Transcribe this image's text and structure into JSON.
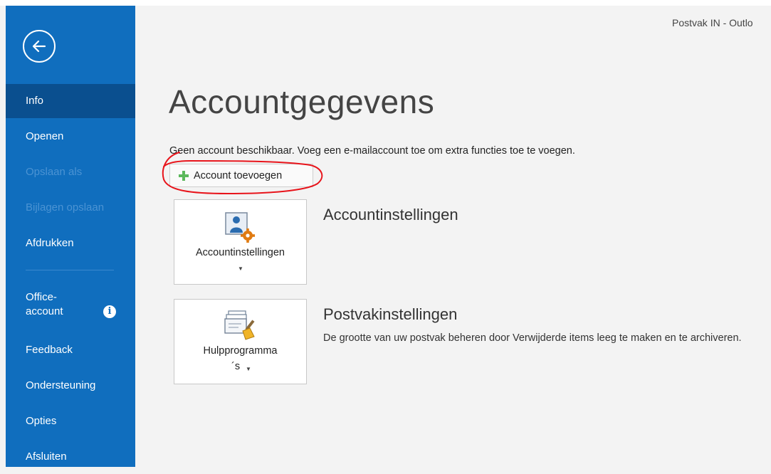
{
  "window": {
    "title": "Postvak IN - Outlo"
  },
  "sidebar": {
    "back_label": "Terug",
    "items": [
      {
        "label": "Info",
        "state": "selected"
      },
      {
        "label": "Openen",
        "state": "enabled"
      },
      {
        "label": "Opslaan als",
        "state": "disabled"
      },
      {
        "label": "Bijlagen opslaan",
        "state": "disabled"
      },
      {
        "label": "Afdrukken",
        "state": "enabled"
      }
    ],
    "office_account": {
      "line1": "Office-",
      "line2": "account"
    },
    "info_icon_glyph": "i",
    "bottom_items": [
      {
        "label": "Feedback"
      },
      {
        "label": "Ondersteuning"
      },
      {
        "label": "Opties"
      },
      {
        "label": "Afsluiten"
      }
    ]
  },
  "main": {
    "title": "Accountgegevens",
    "no_account_text": "Geen account beschikbaar. Voeg een e-mailaccount toe om extra functies toe te voegen.",
    "add_account_button": "Account toevoegen",
    "sections": [
      {
        "tile_label": "Accountinstellingen",
        "tile_icon": "account-settings-icon",
        "title": "Accountinstellingen",
        "description": ""
      },
      {
        "tile_label_line1": "Hulpprogramma",
        "tile_label_line2": "´s",
        "tile_icon": "mailbox-cleanup-icon",
        "title": "Postvakinstellingen",
        "description": "De grootte van uw postvak beheren door Verwijderde items leeg te maken en te archiveren."
      }
    ]
  },
  "colors": {
    "sidebar": "#106ebe",
    "sidebar_selected": "#0a4f8f",
    "sidebar_disabled_text": "#4b93d3",
    "plus_icon": "#5cb85c",
    "annotation": "#e8141b"
  }
}
